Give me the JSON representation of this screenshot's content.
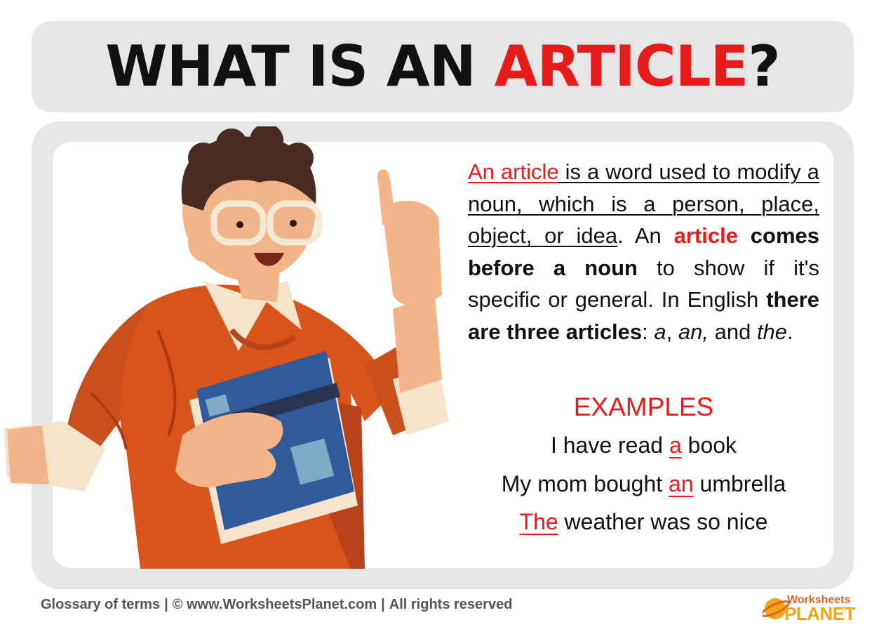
{
  "title": {
    "prefix": "WHAT IS AN ",
    "accent": "ARTICLE",
    "suffix": "?"
  },
  "definition": {
    "p1_red": "An article",
    "p1_rest": " is a word used to modify a noun, which is a person, place, object, or idea",
    "p1_end": ".",
    "p2_a": "An ",
    "p2_red": "article",
    "p2_b": " comes before a noun",
    "p2_c": " to show if it's specific or general. In English ",
    "p2_d": "there are three articles",
    "p2_e": ": ",
    "p2_a_art": "a",
    "p2_comma1": ", ",
    "p2_an_art": "an,",
    "p2_and": " and ",
    "p2_the_art": "the",
    "p2_end": "."
  },
  "examples": {
    "heading": "EXAMPLES",
    "items": [
      {
        "before": "I have read ",
        "article": "a",
        "after": " book"
      },
      {
        "before": "My mom bought ",
        "article": "an",
        "after": " umbrella"
      },
      {
        "before": "",
        "article": "The",
        "after": " weather was so nice"
      }
    ]
  },
  "footer": {
    "glossary": "Glossary of terms",
    "divider": "|",
    "copyright": "© www.WorksheetsPlanet.com",
    "rights": "All rights reserved"
  },
  "logo": {
    "top": "Worksheets",
    "bottom": "PLANET"
  },
  "colors": {
    "accent": "#e81b1b",
    "panel": "#e6e6e6",
    "sweater": "#d9541b",
    "book": "#2f5b9a"
  }
}
